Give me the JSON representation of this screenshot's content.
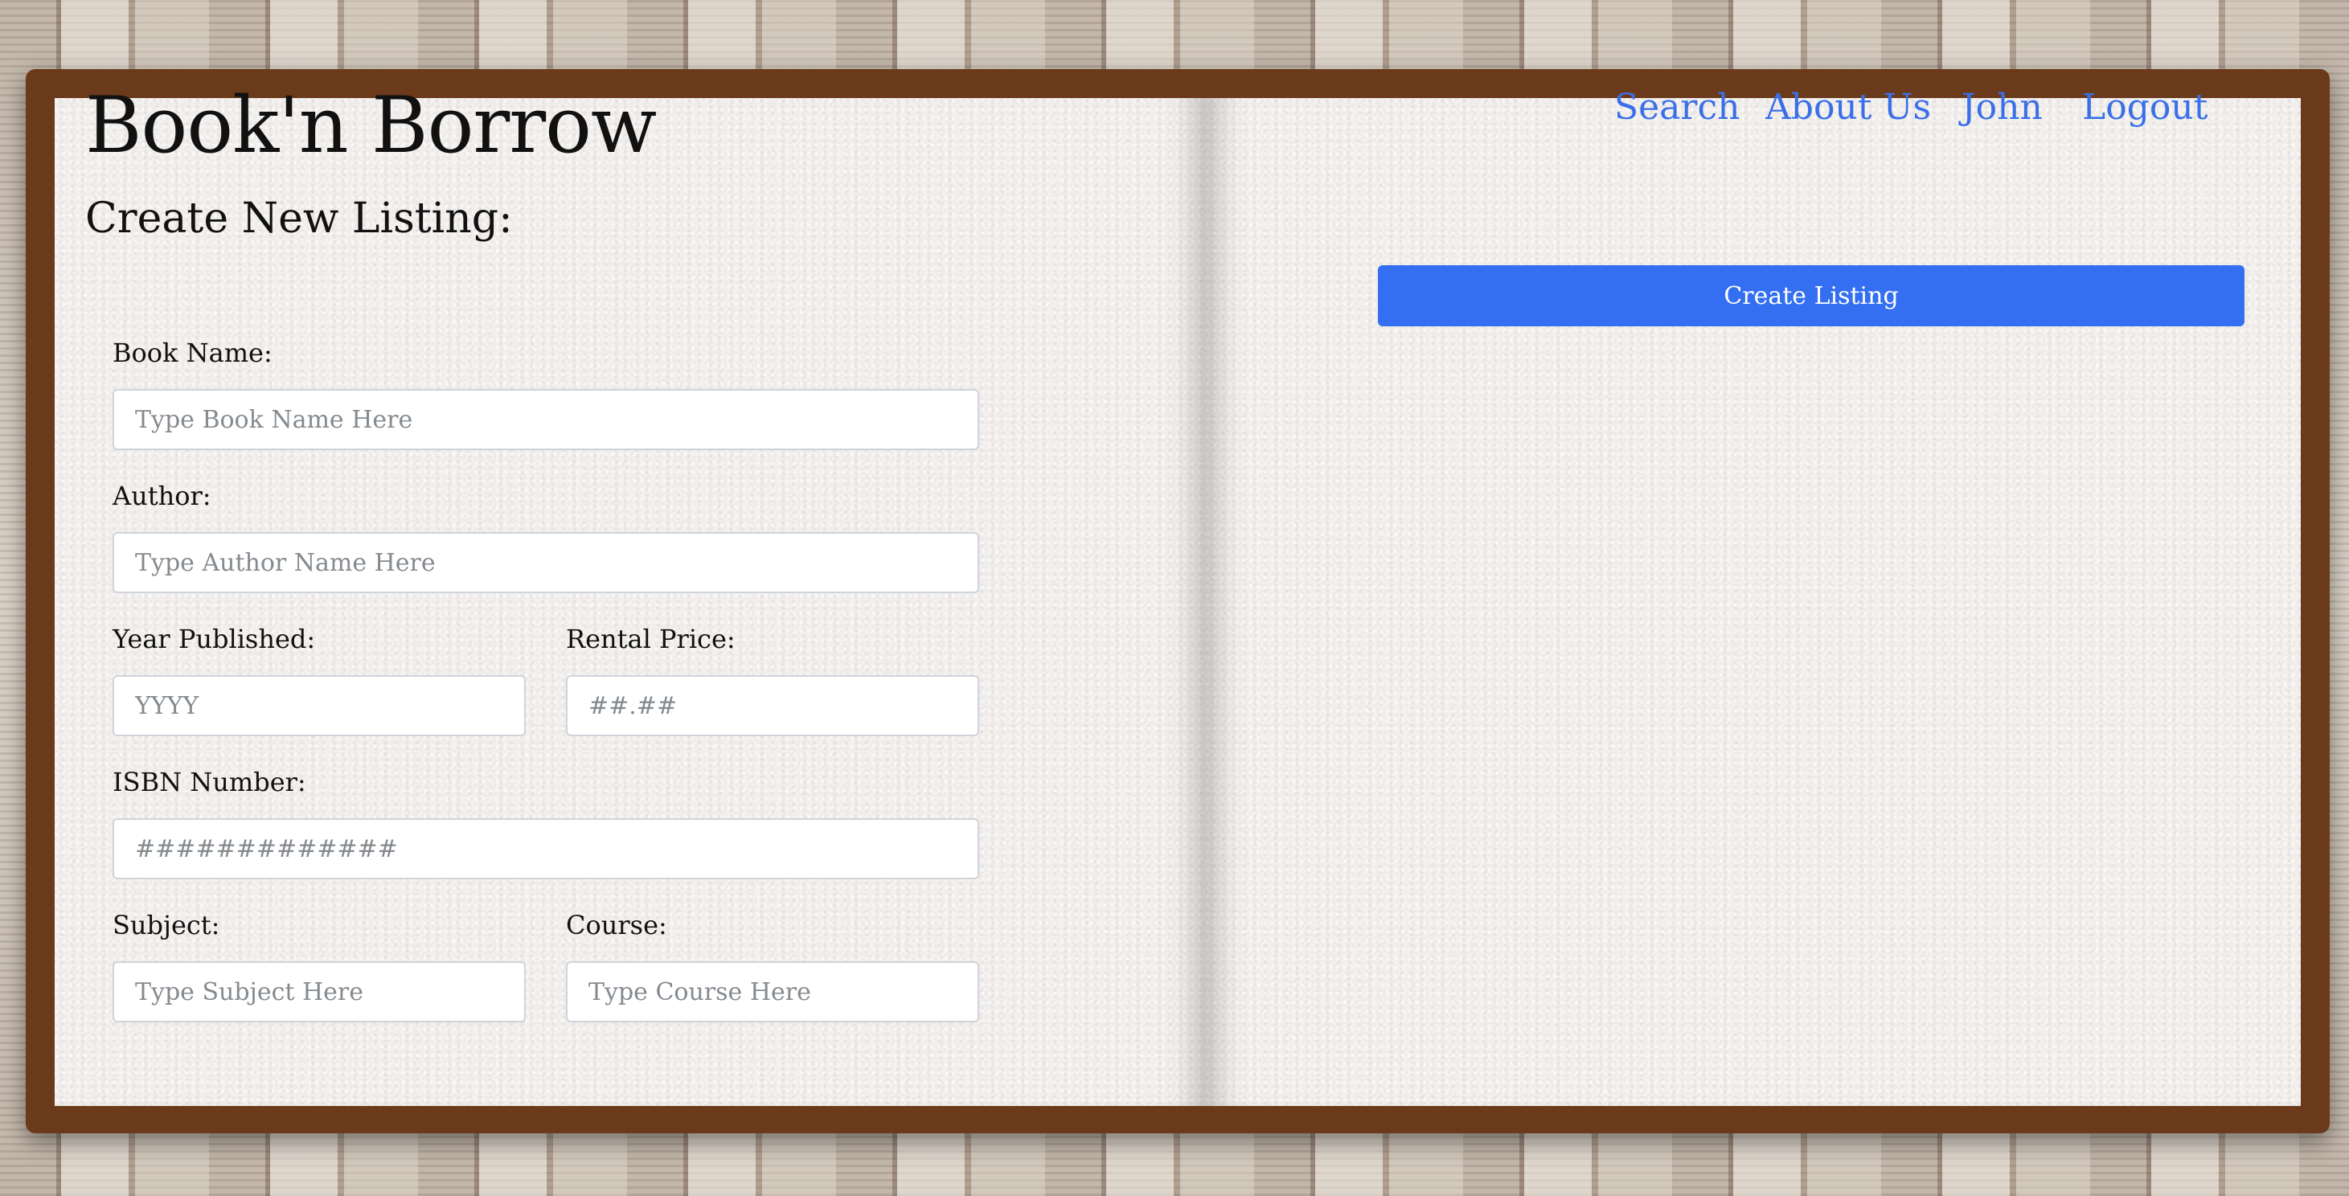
{
  "header": {
    "app_title": "Book'n Borrow"
  },
  "nav": {
    "search": "Search",
    "about": "About Us",
    "user": "John",
    "logout": "Logout"
  },
  "form": {
    "title": "Create New Listing:",
    "book_name": {
      "label": "Book Name:",
      "placeholder": "Type Book Name Here",
      "value": ""
    },
    "author": {
      "label": "Author:",
      "placeholder": "Type Author Name Here",
      "value": ""
    },
    "year": {
      "label": "Year Published:",
      "placeholder": "YYYY",
      "value": ""
    },
    "price": {
      "label": "Rental Price:",
      "placeholder": "##.##",
      "value": ""
    },
    "isbn": {
      "label": "ISBN Number:",
      "placeholder": "#############",
      "value": ""
    },
    "subject": {
      "label": "Subject:",
      "placeholder": "Type Subject Here",
      "value": ""
    },
    "course": {
      "label": "Course:",
      "placeholder": "Type Course Here",
      "value": ""
    },
    "submit_label": "Create Listing"
  },
  "colors": {
    "accent": "#336ff0",
    "link": "#3a6fe8",
    "cover": "#6a3a1a",
    "page": "#f3f0ee"
  }
}
